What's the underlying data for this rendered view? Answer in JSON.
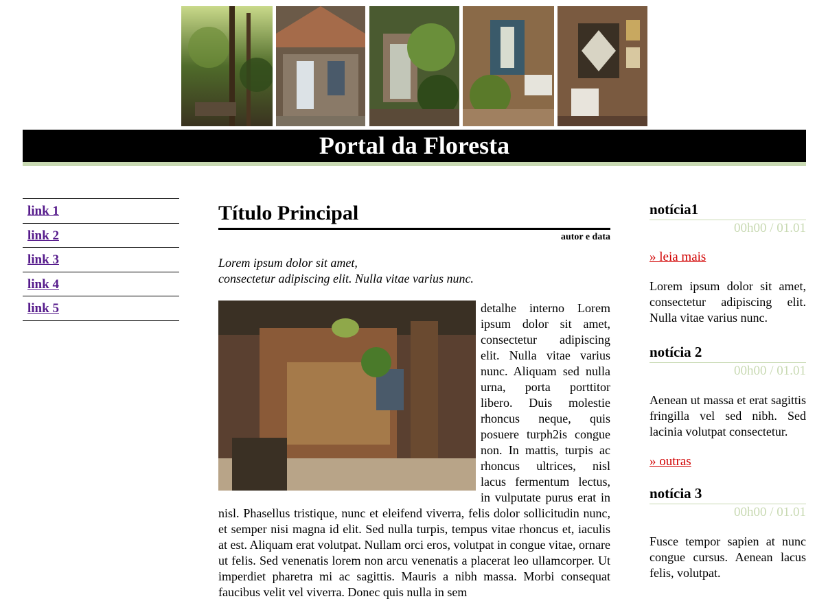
{
  "header": {
    "photos": [
      {
        "icon": "forest-path-photo"
      },
      {
        "icon": "cottage-photo"
      },
      {
        "icon": "garden-gate-photo"
      },
      {
        "icon": "interior-stair-photo"
      },
      {
        "icon": "wall-display-photo"
      }
    ],
    "title": "Portal da Floresta"
  },
  "nav": {
    "items": [
      {
        "label": "link 1"
      },
      {
        "label": "link 2"
      },
      {
        "label": "link 3"
      },
      {
        "label": "link 4"
      },
      {
        "label": "link 5"
      }
    ]
  },
  "main": {
    "title": "Título Principal",
    "byline": "autor e data",
    "lead_line1": "Lorem ipsum dolor sit amet,",
    "lead_line2": "consectetur adipiscing elit. Nulla vitae varius nunc.",
    "image_icon": "interior-lobby-photo",
    "body": "detalhe interno Lorem ipsum dolor sit amet, consectetur adipiscing elit. Nulla vitae varius nunc. Aliquam sed nulla urna, porta porttitor libero. Duis molestie rhoncus neque, quis posuere turph2is congue non. In mattis, turpis ac rhoncus ultrices, nisl lacus fermentum lectus, in vulputate purus erat in nisl. Phasellus tristique, nunc et eleifend viverra, felis dolor sollicitudin nunc, et semper nisi magna id elit. Sed nulla turpis, tempus vitae rhoncus et, iaculis at est. Aliquam erat volutpat. Nullam orci eros, volutpat in congue vitae, ornare ut felis. Sed venenatis lorem non arcu venenatis a placerat leo ullamcorper. Ut imperdiet pharetra mi ac sagittis. Mauris a nibh massa. Morbi consequat faucibus velit vel viverra. Donec quis nulla in sem"
  },
  "news": {
    "items": [
      {
        "title": "notícia1",
        "time": "00h00 / 01.01",
        "link": "» leia mais",
        "text": "Lorem ipsum dolor sit amet, consectetur adipiscing elit. Nulla vitae varius nunc."
      },
      {
        "title": "notícia 2",
        "time": "00h00 / 01.01",
        "text": "Aenean ut massa et erat sagittis fringilla vel sed nibh. Sed lacinia volutpat consectetur.",
        "link": "» outras"
      },
      {
        "title": "notícia 3",
        "time": "00h00 / 01.01",
        "text": "Fusce tempor sapien at nunc congue cursus. Aenean lacus felis, volutpat."
      }
    ]
  },
  "colors": {
    "accent": "#c8d9b2",
    "link_visited": "#551a8b",
    "news_link": "#d10000"
  }
}
